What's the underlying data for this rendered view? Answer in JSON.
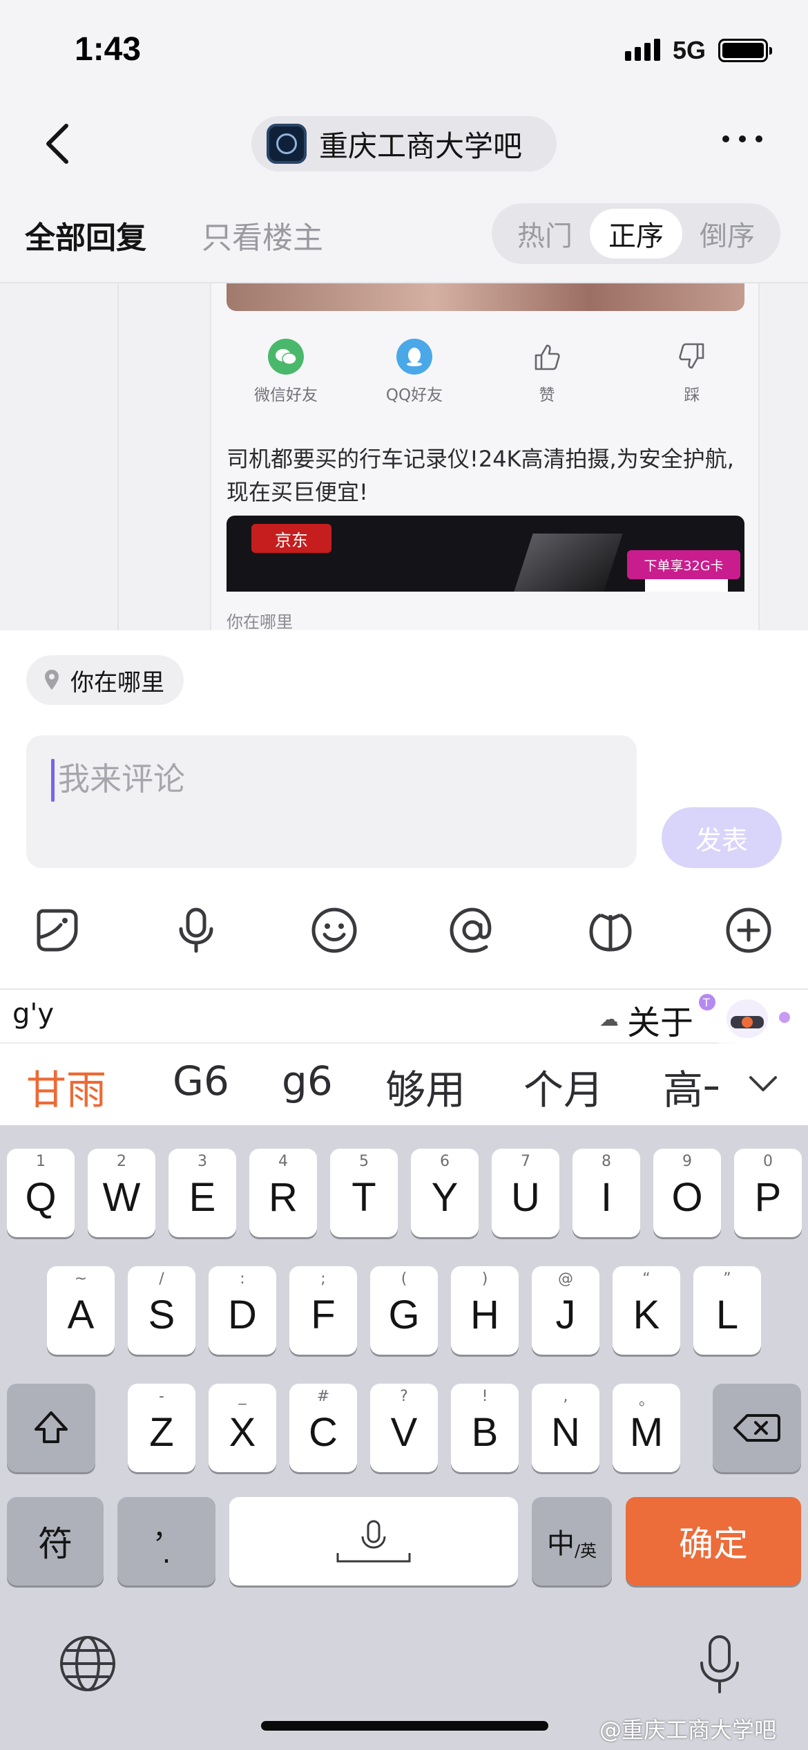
{
  "status_bar": {
    "time": "1:43",
    "network": "5G"
  },
  "nav": {
    "forum_name": "重庆工商大学吧"
  },
  "tabs": {
    "all_replies": "全部回复",
    "owner_only": "只看楼主"
  },
  "sort": {
    "hot": "热门",
    "ascending": "正序",
    "descending": "倒序",
    "selected": "正序"
  },
  "post": {
    "share": [
      {
        "label": "微信好友",
        "icon": "wechat-icon"
      },
      {
        "label": "QQ好友",
        "icon": "qq-icon"
      },
      {
        "label": "赞",
        "icon": "thumbs-up-icon"
      },
      {
        "label": "踩",
        "icon": "thumbs-down-icon"
      }
    ],
    "ad_text": "司机都要买的行车记录仪!24K高清拍摄,为安全护航,现在买巨便宜!",
    "ad_brand": "京东",
    "ad_badge": "下单享32G卡",
    "location_peek": "你在哪里"
  },
  "composer": {
    "location_label": "你在哪里",
    "placeholder": "我来评论",
    "publish_label": "发表",
    "tools": [
      "sticker-icon",
      "microphone-icon",
      "emoji-icon",
      "mention-icon",
      "gift-icon",
      "add-icon"
    ]
  },
  "ime": {
    "pinyin": "g'y",
    "cloud_phrase": "关于",
    "candidates": [
      "甘雨",
      "G6",
      "g6",
      "够用",
      "个月",
      "高一"
    ]
  },
  "keyboard": {
    "row1": [
      {
        "key": "Q",
        "hint": "1"
      },
      {
        "key": "W",
        "hint": "2"
      },
      {
        "key": "E",
        "hint": "3"
      },
      {
        "key": "R",
        "hint": "4"
      },
      {
        "key": "T",
        "hint": "5"
      },
      {
        "key": "Y",
        "hint": "6"
      },
      {
        "key": "U",
        "hint": "7"
      },
      {
        "key": "I",
        "hint": "8"
      },
      {
        "key": "O",
        "hint": "9"
      },
      {
        "key": "P",
        "hint": "0"
      }
    ],
    "row2": [
      {
        "key": "A",
        "hint": "~"
      },
      {
        "key": "S",
        "hint": "/"
      },
      {
        "key": "D",
        "hint": ":"
      },
      {
        "key": "F",
        "hint": ";"
      },
      {
        "key": "G",
        "hint": "("
      },
      {
        "key": "H",
        "hint": ")"
      },
      {
        "key": "J",
        "hint": "@"
      },
      {
        "key": "K",
        "hint": "“"
      },
      {
        "key": "L",
        "hint": "”"
      }
    ],
    "row3": [
      {
        "key": "Z",
        "hint": "-"
      },
      {
        "key": "X",
        "hint": "_"
      },
      {
        "key": "C",
        "hint": "#"
      },
      {
        "key": "V",
        "hint": "?"
      },
      {
        "key": "B",
        "hint": "!"
      },
      {
        "key": "N",
        "hint": ","
      },
      {
        "key": "M",
        "hint": "。"
      }
    ],
    "symbols_label": "符",
    "punct_label": "，\n.",
    "lang_main": "中",
    "lang_sub": "/英",
    "confirm_label": "确定"
  },
  "watermark": "@重庆工商大学吧",
  "colors": {
    "accent_orange": "#ec6c3a",
    "publish_disabled": "#d9d4fa",
    "cursor": "#7a64e8"
  }
}
